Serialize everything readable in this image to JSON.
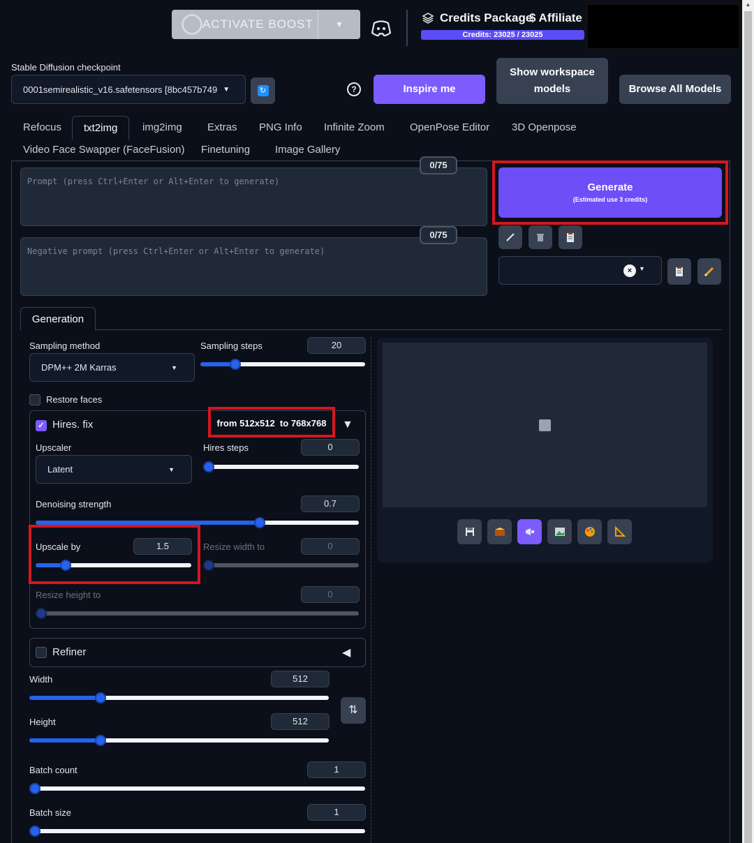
{
  "topbar": {
    "boost_label": "ACTIVATE BOOST",
    "credits_title": "Credits Package",
    "affiliate": "$ Affiliate",
    "credits_text": "Credits: 23025 / 23025"
  },
  "checkpoint": {
    "label": "Stable Diffusion checkpoint",
    "value": "0001semirealistic_v16.safetensors [8bc457b749"
  },
  "buttons": {
    "inspire": "Inspire me",
    "workspace": "Show workspace models",
    "browse": "Browse All Models",
    "help": "?"
  },
  "tabs": [
    "Refocus",
    "txt2img",
    "img2img",
    "Extras",
    "PNG Info",
    "Infinite Zoom",
    "OpenPose Editor",
    "3D Openpose",
    "Video Face Swapper (FaceFusion)",
    "Finetuning",
    "Image Gallery"
  ],
  "prompt": {
    "placeholder": "Prompt (press Ctrl+Enter or Alt+Enter to generate)",
    "counter": "0/75",
    "neg_placeholder": "Negative prompt (press Ctrl+Enter or Alt+Enter to generate)",
    "neg_counter": "0/75"
  },
  "generate": {
    "label": "Generate",
    "sub": "(Estimated use 3 credits)"
  },
  "generation_tab": "Generation",
  "sampling": {
    "method_label": "Sampling method",
    "method_value": "DPM++ 2M Karras",
    "steps_label": "Sampling steps",
    "steps_value": "20",
    "steps_fraction": 0.19
  },
  "restore_faces": "Restore faces",
  "hires": {
    "label": "Hires. fix",
    "checked": true,
    "size_from": "512x512",
    "size_to": "768x768",
    "from_word": "from",
    "to_word": "to",
    "upscaler_label": "Upscaler",
    "upscaler_value": "Latent",
    "steps_label": "Hires steps",
    "steps_value": "0",
    "denoise_label": "Denoising strength",
    "denoise_value": "0.7",
    "denoise_fraction": 0.7,
    "upscale_label": "Upscale by",
    "upscale_value": "1.5",
    "resize_w_label": "Resize width to",
    "resize_w_value": "0",
    "resize_h_label": "Resize height to",
    "resize_h_value": "0"
  },
  "refiner": {
    "label": "Refiner"
  },
  "size": {
    "width_label": "Width",
    "width_value": "512",
    "height_label": "Height",
    "height_value": "512"
  },
  "batch": {
    "count_label": "Batch count",
    "count_value": "1",
    "size_label": "Batch size",
    "size_value": "1"
  },
  "icons": {
    "boost": "spinner-ring-icon",
    "discord": "discord-icon",
    "credits": "layers-icon",
    "pencil": "pencil-icon",
    "trash": "trash-icon",
    "clipboard": "clipboard-icon",
    "save": "save-icon",
    "zip": "archive-icon",
    "send": "send-icon",
    "img2img": "image-icon",
    "inpaint": "palette-icon",
    "extras": "ruler-icon",
    "swap": "swap-icon"
  },
  "colors": {
    "accent": "#7c5cff",
    "highlight": "#d6161f",
    "background": "#0b0f19"
  }
}
